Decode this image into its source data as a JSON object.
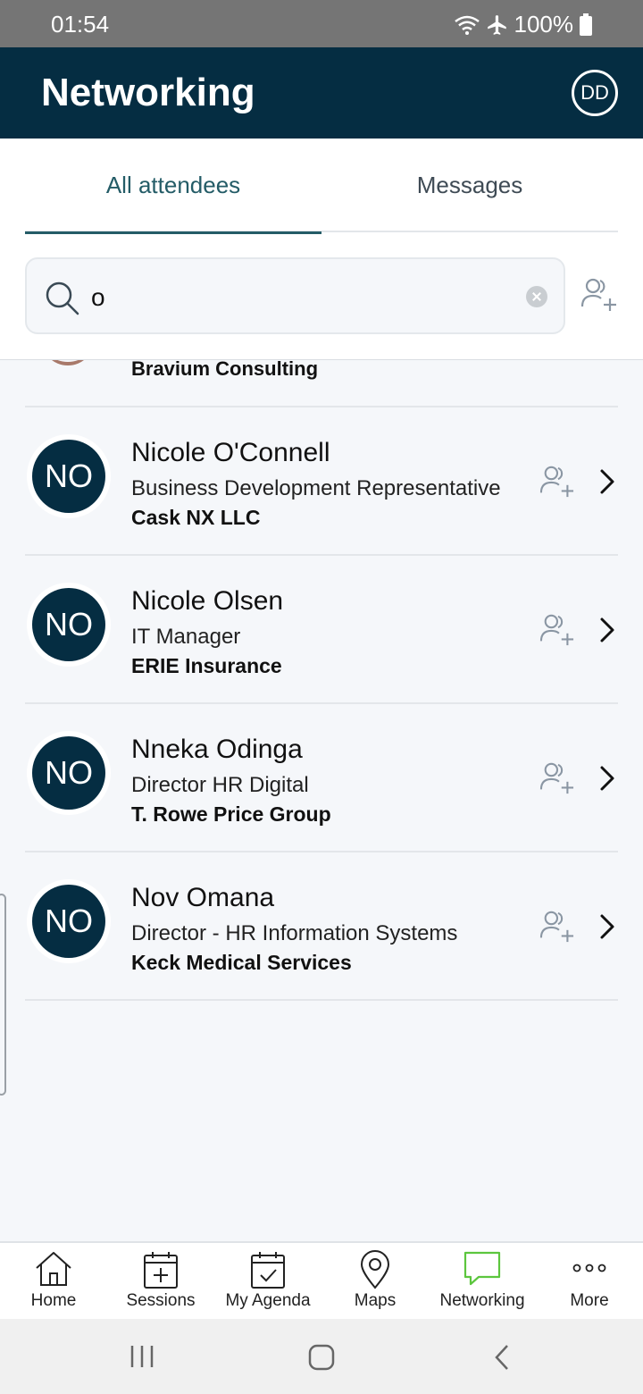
{
  "status_bar": {
    "time": "01:54",
    "battery": "100%"
  },
  "header": {
    "title": "Networking",
    "avatar_initials": "DD"
  },
  "tabs": [
    {
      "label": "All attendees",
      "active": true
    },
    {
      "label": "Messages",
      "active": false
    }
  ],
  "search": {
    "value": "o"
  },
  "partial_row": {
    "company": "Bravium Consulting"
  },
  "attendees": [
    {
      "initials": "NO",
      "name": "Nicole O'Connell",
      "title": "Business Development Representative",
      "company": "Cask NX LLC"
    },
    {
      "initials": "NO",
      "name": "Nicole Olsen",
      "title": "IT Manager",
      "company": "ERIE Insurance"
    },
    {
      "initials": "NO",
      "name": "Nneka Odinga",
      "title": "Director HR Digital",
      "company": "T. Rowe Price Group"
    },
    {
      "initials": "NO",
      "name": "Nov Omana",
      "title": "Director - HR Information Systems",
      "company": "Keck Medical Services"
    }
  ],
  "bottom_nav": [
    {
      "label": "Home",
      "icon": "home-icon"
    },
    {
      "label": "Sessions",
      "icon": "calendar-plus-icon"
    },
    {
      "label": "My Agenda",
      "icon": "calendar-check-icon"
    },
    {
      "label": "Maps",
      "icon": "map-pin-icon"
    },
    {
      "label": "Networking",
      "icon": "chat-icon",
      "active": true
    },
    {
      "label": "More",
      "icon": "more-dots-icon"
    }
  ],
  "colors": {
    "header_bg": "#052d42",
    "accent": "#245c67",
    "networking_active": "#5cc63e"
  }
}
